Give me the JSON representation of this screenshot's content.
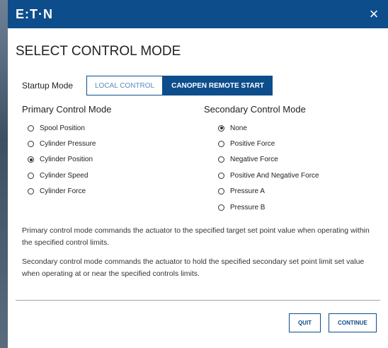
{
  "header": {
    "logo_text": "E:T·N",
    "close_icon": "×",
    "brand_color": "#0d4d8c"
  },
  "title": "SELECT CONTROL MODE",
  "startup": {
    "label": "Startup Mode",
    "options": [
      "LOCAL CONTROL",
      "CANOPEN REMOTE START"
    ],
    "selected": "CANOPEN REMOTE START"
  },
  "primary": {
    "heading": "Primary Control Mode",
    "options": [
      {
        "label": "Spool Position",
        "checked": false
      },
      {
        "label": "Cylinder Pressure",
        "checked": false
      },
      {
        "label": "Cylinder Position",
        "checked": true
      },
      {
        "label": "Cylinder Speed",
        "checked": false
      },
      {
        "label": "Cylinder Force",
        "checked": false
      }
    ]
  },
  "secondary": {
    "heading": "Secondary Control Mode",
    "options": [
      {
        "label": "None",
        "checked": true
      },
      {
        "label": "Positive Force",
        "checked": false
      },
      {
        "label": "Negative Force",
        "checked": false
      },
      {
        "label": "Positive And Negative Force",
        "checked": false
      },
      {
        "label": "Pressure A",
        "checked": false
      },
      {
        "label": "Pressure B",
        "checked": false
      }
    ]
  },
  "descriptions": {
    "primary": "Primary control mode commands the actuator to the specified target set point value when operating within the specified control limits.",
    "secondary": "Secondary control mode commands the actuator to hold the specified secondary set point limit set value when operating at or near the specified controls limits."
  },
  "footer": {
    "quit_label": "QUIT",
    "continue_label": "CONTINUE"
  }
}
